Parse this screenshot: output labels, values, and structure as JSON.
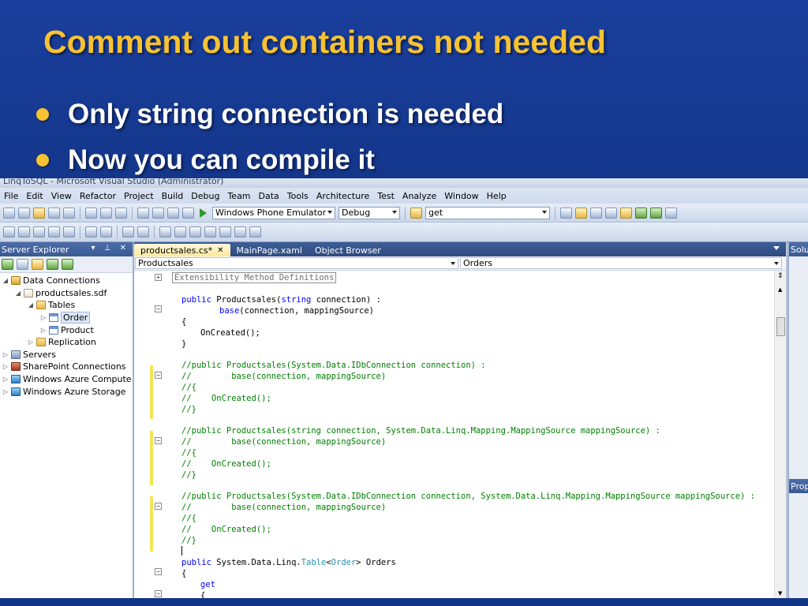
{
  "slide": {
    "title": "Comment out containers not needed",
    "bullets": [
      "Only string connection is needed",
      "Now you can compile it"
    ]
  },
  "vs": {
    "window_title": "LinqToSQL - Microsoft Visual Studio (Administrator)",
    "menu": [
      "File",
      "Edit",
      "View",
      "Refactor",
      "Project",
      "Build",
      "Debug",
      "Team",
      "Data",
      "Tools",
      "Architecture",
      "Test",
      "Analyze",
      "Window",
      "Help"
    ],
    "toolbar": {
      "target": "Windows Phone Emulator",
      "config": "Debug",
      "find": "get"
    },
    "server_explorer": {
      "title": "Server Explorer",
      "tree": [
        {
          "label": "Data Connections",
          "icon": "database-icon"
        },
        {
          "label": "productsales.sdf",
          "icon": "sdf-file-icon"
        },
        {
          "label": "Tables",
          "icon": "folder-icon"
        },
        {
          "label": "Order",
          "icon": "table-icon"
        },
        {
          "label": "Product",
          "icon": "table-icon"
        },
        {
          "label": "Replication",
          "icon": "folder-icon"
        },
        {
          "label": "Servers",
          "icon": "server-icon"
        },
        {
          "label": "SharePoint Connections",
          "icon": "sharepoint-icon"
        },
        {
          "label": "Windows Azure Compute",
          "icon": "azure-icon"
        },
        {
          "label": "Windows Azure Storage",
          "icon": "azure-icon"
        }
      ]
    },
    "tabs": [
      "productsales.cs*",
      "MainPage.xaml",
      "Object Browser"
    ],
    "nav": {
      "type": "Productsales",
      "member": "Orders"
    },
    "side_panes": {
      "solution": "Solut",
      "properties": "Prop"
    },
    "code": {
      "region": "Extensibility Method Definitions",
      "l1_kw": "public",
      "l1_rest": " Productsales(",
      "l1_kw2": "string",
      "l1_rest2": " connection) :",
      "l2_kw": "base",
      "l2_rest": "(connection, mappingSource)",
      "l3": "{",
      "l4": "OnCreated();",
      "l5": "}",
      "c1a": "//public Productsales(System.Data.IDbConnection connection) :",
      "c1b": "//        base(connection, mappingSource)",
      "c1c": "//{",
      "c1d": "//    OnCreated();",
      "c1e": "//}",
      "c2a": "//public Productsales(string connection, System.Data.Linq.Mapping.MappingSource mappingSource) :",
      "c2b": "//        base(connection, mappingSource)",
      "c2c": "//{",
      "c2d": "//    OnCreated();",
      "c2e": "//}",
      "c3a": "//public Productsales(System.Data.IDbConnection connection, System.Data.Linq.Mapping.MappingSource mappingSource) :",
      "c3b": "//        base(connection, mappingSource)",
      "c3c": "//{",
      "c3d": "//    OnCreated();",
      "c3e": "//}",
      "p_kw": "public",
      "p_ns": " System.Data.Linq.",
      "p_type": "Table",
      "p_lt": "<",
      "p_arg": "Order",
      "p_gt": "> Orders",
      "p_brace": "{",
      "p_get": "get",
      "p_inner": "{"
    }
  }
}
